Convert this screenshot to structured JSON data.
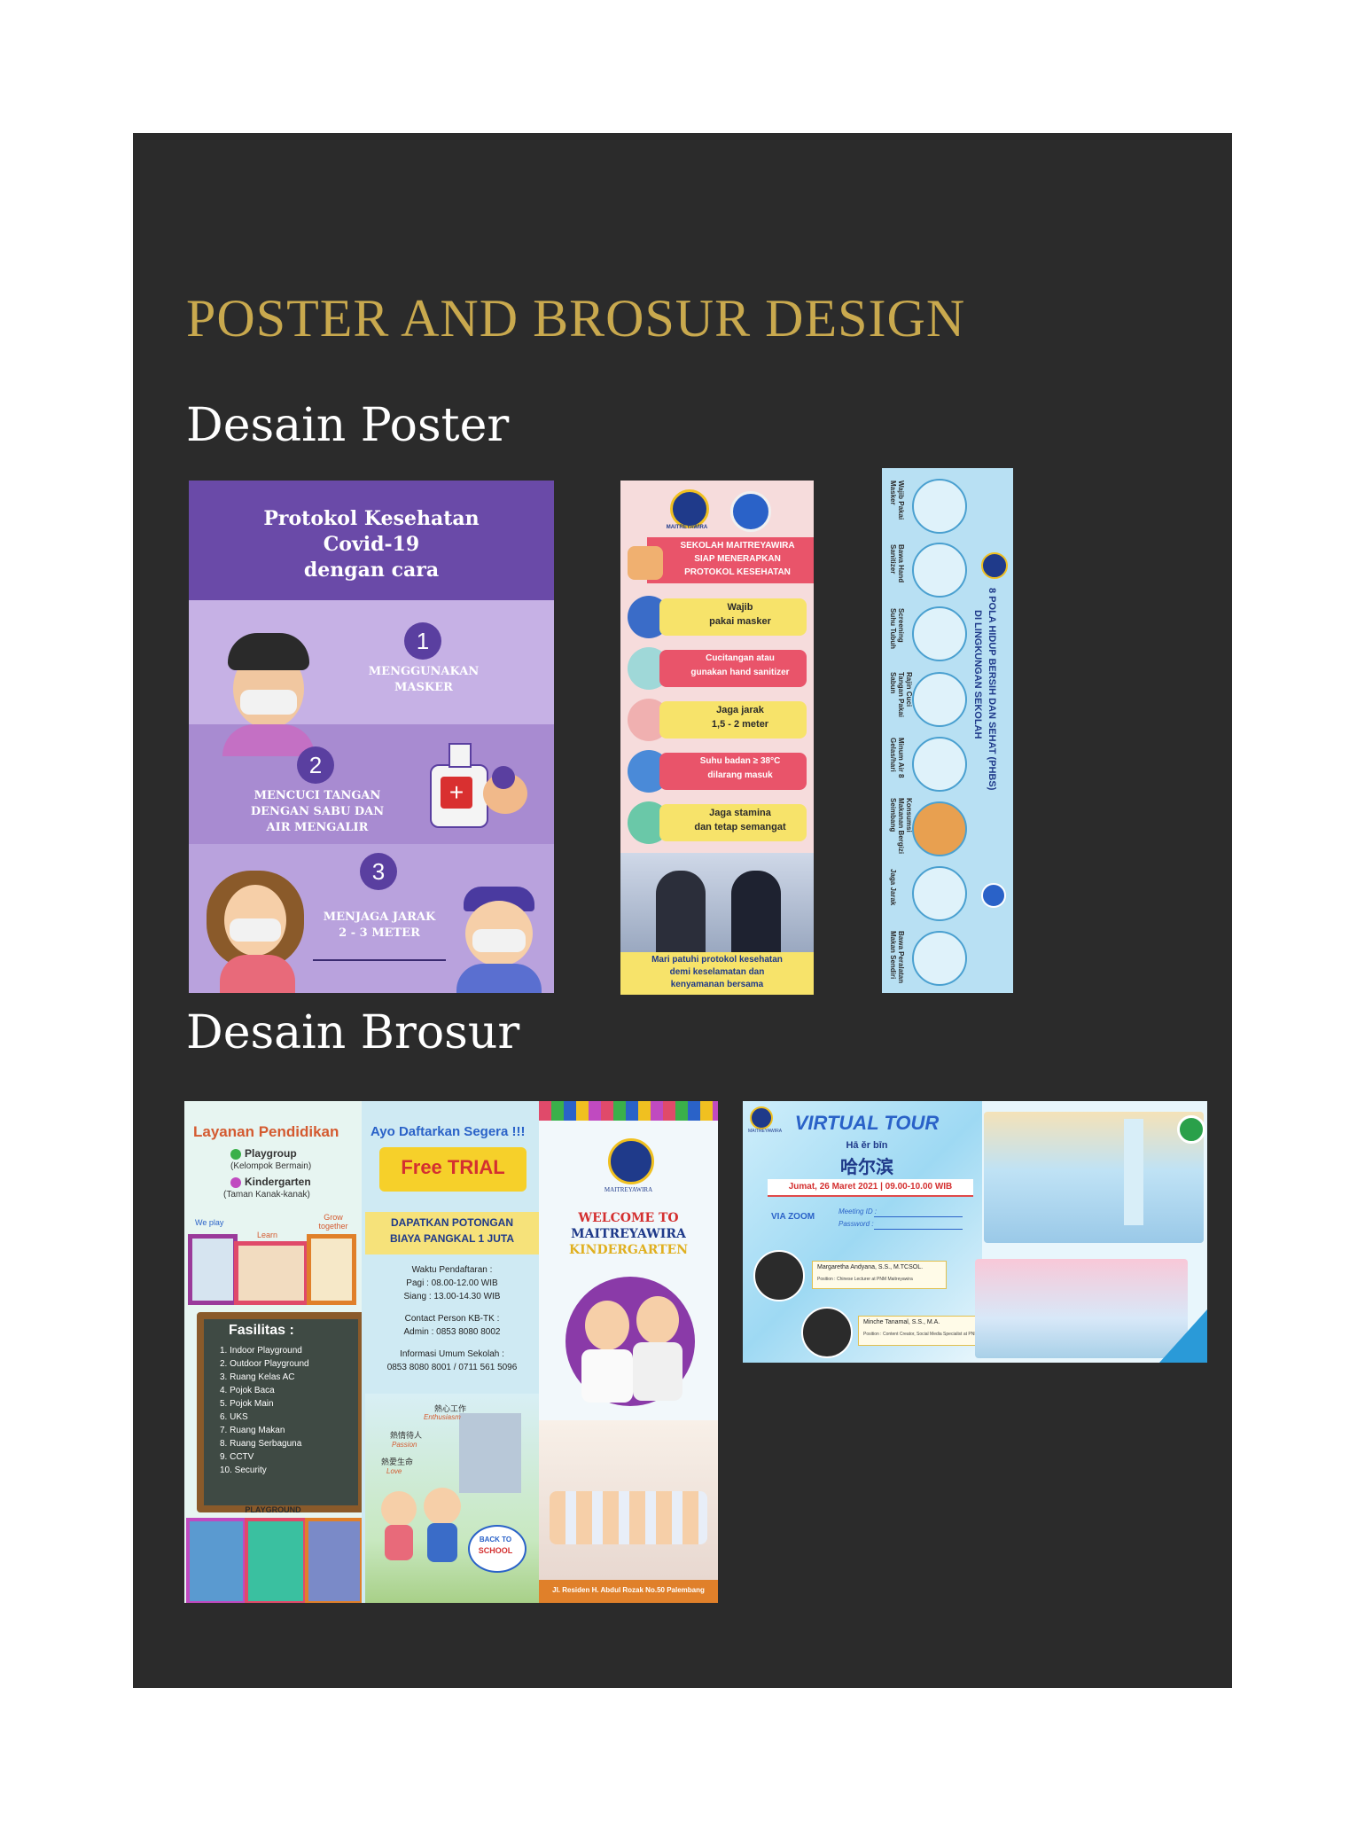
{
  "page": {
    "title": "POSTER AND BROSUR DESIGN",
    "poster_heading": "Desain Poster",
    "brosur_heading": "Desain Brosur"
  },
  "poster1": {
    "title_lines": [
      "Protokol Kesehatan",
      "Covid-19",
      "dengan cara"
    ],
    "steps": [
      {
        "num": "1",
        "text_lines": [
          "MENGGUNAKAN",
          "MASKER"
        ]
      },
      {
        "num": "2",
        "text_lines": [
          "MENCUCI TANGAN",
          "DENGAN SABU DAN",
          "AIR MENGALIR"
        ]
      },
      {
        "num": "3",
        "text_lines": [
          "MENJAGA JARAK",
          "2 - 3 METER"
        ]
      }
    ]
  },
  "poster2": {
    "logo_text": "MAITREYAWIRA",
    "header_lines": [
      "SEKOLAH MAITREYAWIRA",
      "SIAP MENERAPKAN",
      "PROTOKOL KESEHATAN"
    ],
    "items": [
      [
        "Wajib",
        "pakai masker"
      ],
      [
        "Cucitangan atau",
        "gunakan hand sanitizer"
      ],
      [
        "Jaga jarak",
        "1,5 - 2 meter"
      ],
      [
        "Suhu badan ≥ 38°C",
        "dilarang masuk"
      ],
      [
        "Jaga stamina",
        "dan tetap semangat"
      ]
    ],
    "footer_lines": [
      "Mari patuhi protokol kesehatan",
      "demi keselamatan dan",
      "kenyamanan bersama"
    ]
  },
  "poster3": {
    "title_lines": [
      "8 POLA HIDUP BERSIH DAN SEHAT (PHBS)",
      "DI LINGKUNGAN SEKOLAH"
    ],
    "logo_text": "MAITREYAWIRA",
    "items": [
      "Wajib Pakai Masker",
      "Bawa Hand Sanitizer",
      "Screening Suhu Tubuh",
      "Rajin Cuci Tangan Pakai Sabun",
      "Minum Air 8 Gelas/hari",
      "Konsumsi Makanan Bergizi Seimbang",
      "Jaga Jarak",
      "Bawa Peralatan Makan Sendiri"
    ]
  },
  "brochure1": {
    "layanan_title": "Layanan Pendidikan",
    "services": [
      {
        "name": "Playgroup",
        "sub": "(Kelompok Bermain)"
      },
      {
        "name": "Kindergarten",
        "sub": "(Taman Kanak-kanak)"
      }
    ],
    "we_labels": [
      "We play",
      "Learn",
      "Grow together"
    ],
    "fasilitas_title": "Fasilitas :",
    "fasilitas": [
      "1. Indoor Playground",
      "2. Outdoor Playground",
      "3. Ruang Kelas AC",
      "4. Pojok Baca",
      "5. Pojok Main",
      "6. UKS",
      "7. Ruang Makan",
      "8. Ruang Serbaguna",
      "9. CCTV",
      "10. Security"
    ],
    "playground_label": "PLAYGROUND",
    "ayo": "Ayo Daftarkan Segera !!!",
    "free_trial": "Free TRIAL",
    "potongan_lines": [
      "DAPATKAN POTONGAN",
      "BIAYA PANGKAL 1 JUTA"
    ],
    "waktu_lines": [
      "Waktu Pendaftaran :",
      "Pagi : 08.00-12.00 WIB",
      "Siang : 13.00-14.30 WIB"
    ],
    "contact_lines": [
      "Contact Person KB-TK :",
      "Admin : 0853 8080 8002"
    ],
    "info_lines": [
      "Informasi Umum Sekolah :",
      "0853 8080 8001 / 0711 561 5096"
    ],
    "chinese_words": [
      "熱心工作",
      "Enthusiasm",
      "熱情待人",
      "Passion",
      "熱愛生命",
      "Love"
    ],
    "back_to_school": [
      "BACK TO",
      "SCHOOL"
    ],
    "logo_text": "MAITREYAWIRA",
    "welcome_lines": [
      "WELCOME TO",
      "MAITREYAWIRA",
      "KINDERGARTEN"
    ],
    "address": "Jl. Residen H. Abdul Rozak No.50 Palembang"
  },
  "brochure2": {
    "logo_text": "MAITREYAWIRA",
    "title": "VIRTUAL TOUR",
    "pinyin": "Hā ěr bīn",
    "chinese": "哈尔滨",
    "date": "Jumat, 26 Maret 2021 | 09.00-10.00 WIB",
    "via": "VIA ZOOM",
    "meeting_id": "Meeting ID :",
    "password": "Password :",
    "speaker1": "Margaretha Andyana, S.S., M.TCSOL.",
    "speaker1_role": "Position : Chinese Lecturer at PNM Maitreyawira",
    "speaker2": "Minche Tanamal, S.S., M.A.",
    "speaker2_role": "Position : Content Creator, Social Media Specialist at PNM Maitreyawira"
  }
}
